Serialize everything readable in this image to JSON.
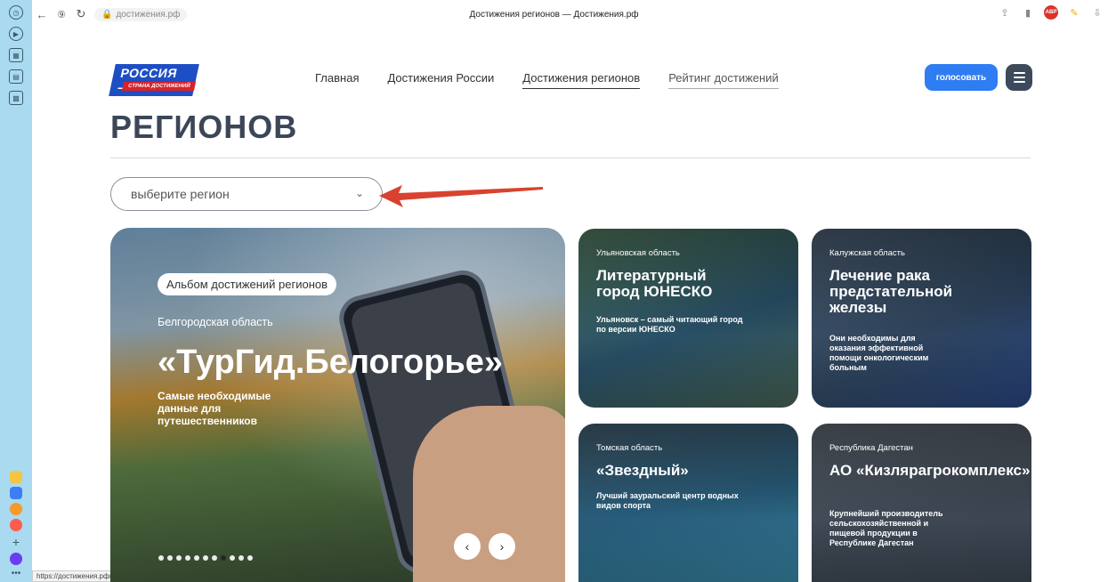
{
  "browser": {
    "domain": "достижения.рф",
    "tab_title": "Достижения регионов — Достижения.рф",
    "status_url": "https://достижения.рф/achievements/rating",
    "abp_label": "ABP"
  },
  "header": {
    "logo_top": "РОССИЯ –",
    "logo_bottom": "СТРАНА ДОСТИЖЕНИЙ",
    "nav": [
      "Главная",
      "Достижения России",
      "Достижения регионов",
      "Рейтинг достижений"
    ],
    "vote_label": "голосовать"
  },
  "page": {
    "heading": "РЕГИОНОВ",
    "select_placeholder": "выберите регион"
  },
  "hero": {
    "pill": "Альбом достижений регионов",
    "region": "Белгородская область",
    "title": "«ТурГид.Белогорье»",
    "desc": "Самые необходимые данные для путешественников",
    "prev": "‹",
    "next": "›"
  },
  "cards": [
    {
      "region": "Ульяновская область",
      "title": "Литературный город ЮНЕСКО",
      "desc": "Ульяновск – самый читающий город по версии ЮНЕСКО"
    },
    {
      "region": "Калужская область",
      "title": "Лечение рака предстательной железы",
      "desc": "Они необходимы для оказания эффективной помощи онкологическим больным"
    },
    {
      "region": "Томская область",
      "title": "«Звездный»",
      "desc": "Лучший зауральский центр водных видов спорта"
    },
    {
      "region": "Республика Дагестан",
      "title": "АО «Кизлярагрокомплекс»",
      "desc": "Крупнейший производитель сельскохозяйственной и пищевой продукции в Республике Дагестан"
    }
  ],
  "colors": {
    "accent": "#2e7df2",
    "heading": "#3b4658",
    "arrow": "#d9422f"
  }
}
